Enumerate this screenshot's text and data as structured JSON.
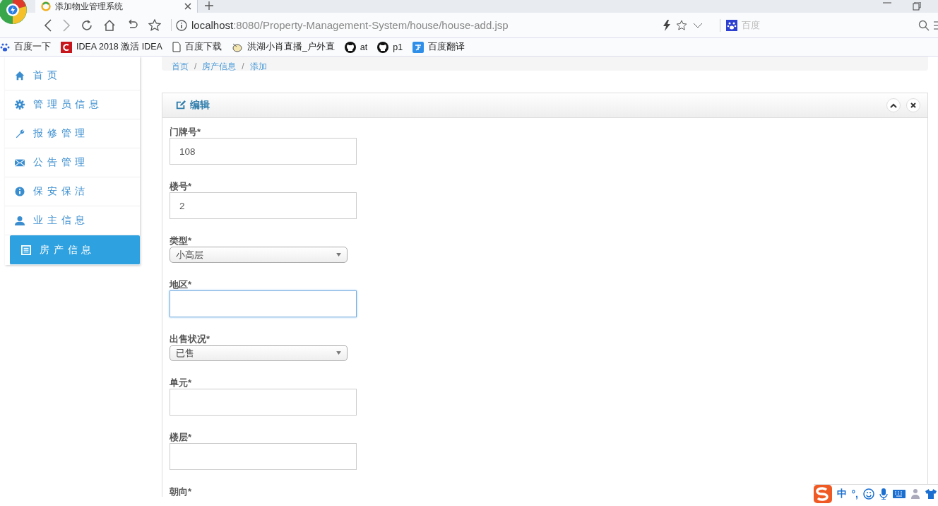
{
  "browser": {
    "tab_title": "添加物业管理系统",
    "url_host": "localhost",
    "url_path": ":8080/Property-Management-System/house/house-add.jsp",
    "search_placeholder": "百度",
    "bookmarks": [
      {
        "label": "百度一下"
      },
      {
        "label": "IDEA 2018 激活 IDEA"
      },
      {
        "label": "百度下载"
      },
      {
        "label": "洪湖小肖直播_户外直"
      },
      {
        "label": "at"
      },
      {
        "label": "p1"
      },
      {
        "label": "百度翻译"
      }
    ]
  },
  "sidebar": {
    "items": [
      {
        "label": "首 页",
        "selected": false
      },
      {
        "label": "管 理 员 信 息",
        "selected": false
      },
      {
        "label": "报 修 管 理",
        "selected": false
      },
      {
        "label": "公 告 管 理",
        "selected": false
      },
      {
        "label": "保 安 保 洁",
        "selected": false
      },
      {
        "label": "业 主 信 息",
        "selected": false
      },
      {
        "label": "房 产 信 息",
        "selected": true
      }
    ]
  },
  "breadcrumb": [
    {
      "text": "首页",
      "kind": "link"
    },
    {
      "text": "/",
      "kind": "separator"
    },
    {
      "text": "房产信息",
      "kind": "link"
    },
    {
      "text": "/",
      "kind": "separator"
    },
    {
      "text": "添加",
      "kind": "link"
    }
  ],
  "panel": {
    "title": "编辑",
    "fields": [
      {
        "label": "门牌号*",
        "kind": "input",
        "value": "108",
        "focused": false
      },
      {
        "label": "楼号*",
        "kind": "input",
        "value": "2",
        "focused": false
      },
      {
        "label": "类型*",
        "kind": "select",
        "value": "小高层"
      },
      {
        "label": "地区*",
        "kind": "input",
        "focused": true
      },
      {
        "label": "出售状况*",
        "kind": "select",
        "value": "已售"
      },
      {
        "label": "单元*",
        "kind": "input",
        "focused": false
      },
      {
        "label": "楼层*",
        "kind": "input",
        "focused": false
      },
      {
        "label": "朝向*",
        "kind": "label"
      }
    ]
  },
  "ime": {
    "mode": "中",
    "punct": "°,"
  }
}
